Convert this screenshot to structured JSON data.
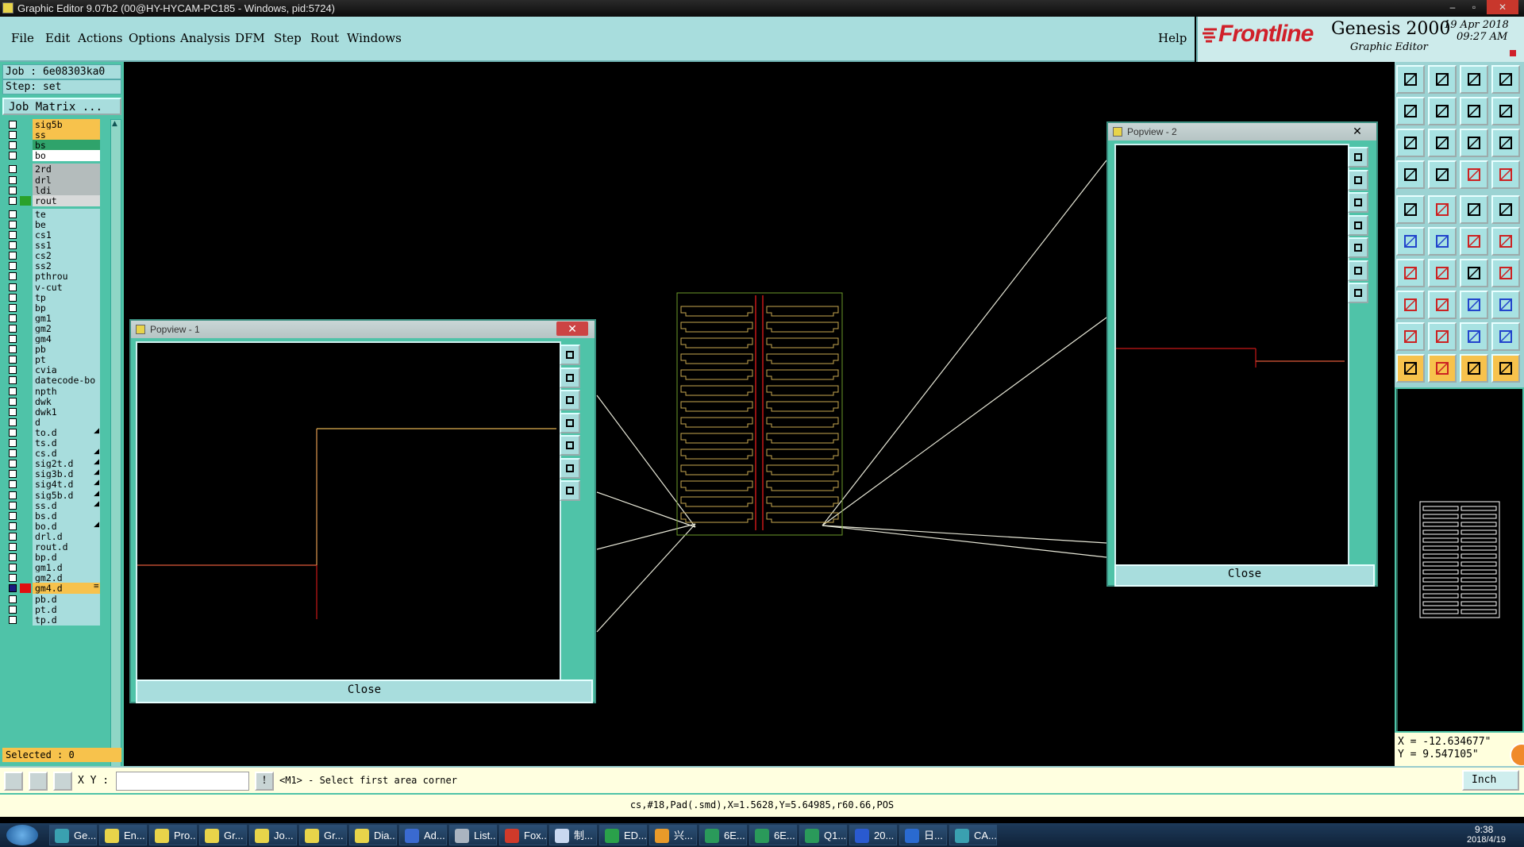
{
  "window": {
    "title": "Graphic Editor 9.07b2 (00@HY-HYCAM-PC185 - Windows, pid:5724)",
    "controls": [
      "–",
      "▫",
      "✕"
    ]
  },
  "menu": {
    "items": [
      "File",
      "Edit",
      "Actions",
      "Options",
      "Analysis",
      "DFM",
      "Step",
      "Rout",
      "Windows"
    ],
    "help": "Help"
  },
  "brand": {
    "logo": "Frontline",
    "product": "Genesis 2000",
    "subtitle": "Graphic Editor",
    "date": "19 Apr 2018",
    "time": "09:27 AM"
  },
  "job": {
    "job_line": "Job : 6e08303ka0",
    "step_line": "Step: set",
    "matrix_button": "Job Matrix ..."
  },
  "layers": [
    {
      "name": "sig5b",
      "color": "#f7c24c",
      "mark": "",
      "active": false
    },
    {
      "name": "ss",
      "color": "#f7c24c",
      "mark": "",
      "active": false
    },
    {
      "name": "bs",
      "color": "#2fa36b",
      "mark": "",
      "active": false
    },
    {
      "name": "bo",
      "color": "#ffffff",
      "mark": "",
      "active": false
    },
    {
      "name": "2rd",
      "color": "#b4bcbc",
      "mark": "",
      "active": false,
      "gap": true
    },
    {
      "name": "drl",
      "color": "#b4bcbc",
      "mark": "",
      "active": false
    },
    {
      "name": "ldi",
      "color": "#b4bcbc",
      "mark": "",
      "active": false
    },
    {
      "name": "rout",
      "color": "#d8dada",
      "mark": "",
      "active": false,
      "swatch": "#2aa12a"
    },
    {
      "name": "te",
      "color": "#a8dddd",
      "mark": "",
      "active": false,
      "gap": true
    },
    {
      "name": "be",
      "color": "#a8dddd",
      "mark": "",
      "active": false
    },
    {
      "name": "cs1",
      "color": "#a8dddd",
      "mark": "",
      "active": false
    },
    {
      "name": "ss1",
      "color": "#a8dddd",
      "mark": "",
      "active": false
    },
    {
      "name": "cs2",
      "color": "#a8dddd",
      "mark": "",
      "active": false
    },
    {
      "name": "ss2",
      "color": "#a8dddd",
      "mark": "",
      "active": false
    },
    {
      "name": "pthrou",
      "color": "#a8dddd",
      "mark": "",
      "active": false
    },
    {
      "name": "v-cut",
      "color": "#a8dddd",
      "mark": "",
      "active": false
    },
    {
      "name": "tp",
      "color": "#a8dddd",
      "mark": "",
      "active": false
    },
    {
      "name": "bp",
      "color": "#a8dddd",
      "mark": "",
      "active": false
    },
    {
      "name": "gm1",
      "color": "#a8dddd",
      "mark": "",
      "active": false
    },
    {
      "name": "gm2",
      "color": "#a8dddd",
      "mark": "",
      "active": false
    },
    {
      "name": "gm4",
      "color": "#a8dddd",
      "mark": "",
      "active": false
    },
    {
      "name": "pb",
      "color": "#a8dddd",
      "mark": "",
      "active": false
    },
    {
      "name": "pt",
      "color": "#a8dddd",
      "mark": "",
      "active": false
    },
    {
      "name": "cvia",
      "color": "#a8dddd",
      "mark": "",
      "active": false
    },
    {
      "name": "datecode-bo",
      "color": "#a8dddd",
      "mark": "",
      "active": false
    },
    {
      "name": "npth",
      "color": "#a8dddd",
      "mark": "",
      "active": false
    },
    {
      "name": "dwk",
      "color": "#a8dddd",
      "mark": "",
      "active": false
    },
    {
      "name": "dwk1",
      "color": "#a8dddd",
      "mark": "",
      "active": false
    },
    {
      "name": "d",
      "color": "#a8dddd",
      "mark": "",
      "active": false
    },
    {
      "name": "to.d",
      "color": "#a8dddd",
      "mark": "◢",
      "active": false
    },
    {
      "name": "ts.d",
      "color": "#a8dddd",
      "mark": "",
      "active": false
    },
    {
      "name": "cs.d",
      "color": "#a8dddd",
      "mark": "◢",
      "active": false
    },
    {
      "name": "sig2t.d",
      "color": "#a8dddd",
      "mark": "◢",
      "active": false
    },
    {
      "name": "sig3b.d",
      "color": "#a8dddd",
      "mark": "◢",
      "active": false
    },
    {
      "name": "sig4t.d",
      "color": "#a8dddd",
      "mark": "◢",
      "active": false
    },
    {
      "name": "sig5b.d",
      "color": "#a8dddd",
      "mark": "◢",
      "active": false
    },
    {
      "name": "ss.d",
      "color": "#a8dddd",
      "mark": "◢",
      "active": false
    },
    {
      "name": "bs.d",
      "color": "#a8dddd",
      "mark": "",
      "active": false
    },
    {
      "name": "bo.d",
      "color": "#a8dddd",
      "mark": "◢",
      "active": false
    },
    {
      "name": "drl.d",
      "color": "#a8dddd",
      "mark": "",
      "active": false
    },
    {
      "name": "rout.d",
      "color": "#a8dddd",
      "mark": "",
      "active": false
    },
    {
      "name": "bp.d",
      "color": "#a8dddd",
      "mark": "",
      "active": false
    },
    {
      "name": "gm1.d",
      "color": "#a8dddd",
      "mark": "",
      "active": false
    },
    {
      "name": "gm2.d",
      "color": "#a8dddd",
      "mark": "",
      "active": false
    },
    {
      "name": "gm4.d",
      "color": "#f7c24c",
      "mark": "≡",
      "active": true,
      "swatch": "#e01010"
    },
    {
      "name": "pb.d",
      "color": "#a8dddd",
      "mark": "",
      "active": false
    },
    {
      "name": "pt.d",
      "color": "#a8dddd",
      "mark": "",
      "active": false
    },
    {
      "name": "tp.d",
      "color": "#a8dddd",
      "mark": "",
      "active": false
    }
  ],
  "selected_text": "Selected : 0",
  "popview1": {
    "title": "Popview - 1",
    "close_label": "Close",
    "close_x": "✕"
  },
  "popview2": {
    "title": "Popview - 2",
    "close_label": "Close",
    "close_x": "✕"
  },
  "coordinates": {
    "x": "X = -12.634677\"",
    "y": "Y = 9.547105\""
  },
  "command": {
    "xy_label": "X Y :",
    "xy_value": "",
    "prompt": "<M1> - Select first area corner",
    "units": "Inch"
  },
  "status": "cs,#18,Pad(.smd),X=1.5628,Y=5.64985,r60.66,POS",
  "taskbar": {
    "items": [
      {
        "label": "Ge...",
        "color": "#3aa0b0"
      },
      {
        "label": "En...",
        "color": "#e8d44a"
      },
      {
        "label": "Pro...",
        "color": "#e8d44a"
      },
      {
        "label": "Gr...",
        "color": "#e8d44a"
      },
      {
        "label": "Jo...",
        "color": "#e8d44a"
      },
      {
        "label": "Gr...",
        "color": "#e8d44a"
      },
      {
        "label": "Dia...",
        "color": "#e8d44a"
      },
      {
        "label": "Ad...",
        "color": "#3a6ad0"
      },
      {
        "label": "List...",
        "color": "#aab4c0"
      },
      {
        "label": "Fox...",
        "color": "#d03a2a"
      },
      {
        "label": "制...",
        "color": "#c8d8f0"
      },
      {
        "label": "ED...",
        "color": "#2aa14a"
      },
      {
        "label": "兴...",
        "color": "#e89a2a"
      },
      {
        "label": "6E...",
        "color": "#2a9a5a"
      },
      {
        "label": "6E...",
        "color": "#2a9a5a"
      },
      {
        "label": "Q1...",
        "color": "#2a9a5a"
      },
      {
        "label": "20...",
        "color": "#2a5ad0"
      },
      {
        "label": "日...",
        "color": "#2a6ad0"
      },
      {
        "label": "CA...",
        "color": "#3aa0b0"
      }
    ],
    "clock": "9:38",
    "date": "2018/4/19"
  }
}
